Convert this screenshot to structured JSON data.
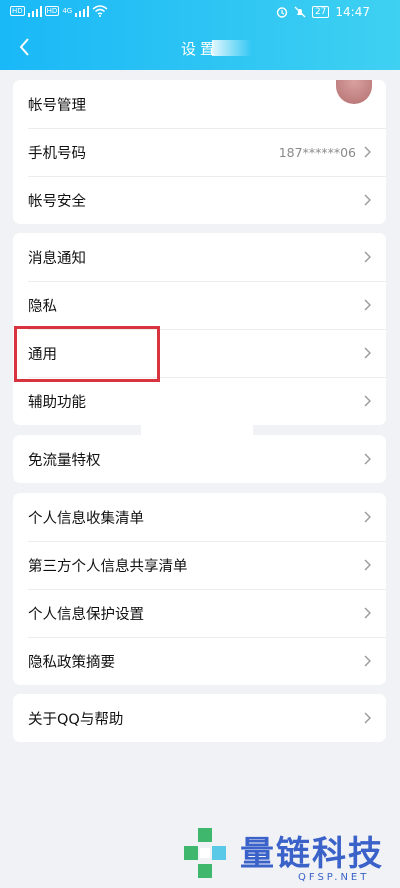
{
  "status": {
    "time": "14:47",
    "battery": "27",
    "net_left": "HD",
    "sig_label": "4G"
  },
  "header": {
    "title": "设置"
  },
  "groups": [
    {
      "items": [
        {
          "label": "帐号管理",
          "value": ""
        },
        {
          "label": "手机号码",
          "value": "187******06"
        },
        {
          "label": "帐号安全",
          "value": ""
        }
      ]
    },
    {
      "items": [
        {
          "label": "消息通知"
        },
        {
          "label": "隐私"
        },
        {
          "label": "通用"
        },
        {
          "label": "辅助功能"
        }
      ]
    },
    {
      "items": [
        {
          "label": "免流量特权"
        }
      ]
    },
    {
      "items": [
        {
          "label": "个人信息收集清单"
        },
        {
          "label": "第三方个人信息共享清单"
        },
        {
          "label": "个人信息保护设置"
        },
        {
          "label": "隐私政策摘要"
        }
      ]
    },
    {
      "items": [
        {
          "label": "关于QQ与帮助"
        }
      ]
    }
  ],
  "watermark": {
    "text": "量链科技",
    "sub": "QFSP.NET"
  },
  "colors": {
    "accent": "#19b8f7",
    "highlight": "#d8343f"
  }
}
